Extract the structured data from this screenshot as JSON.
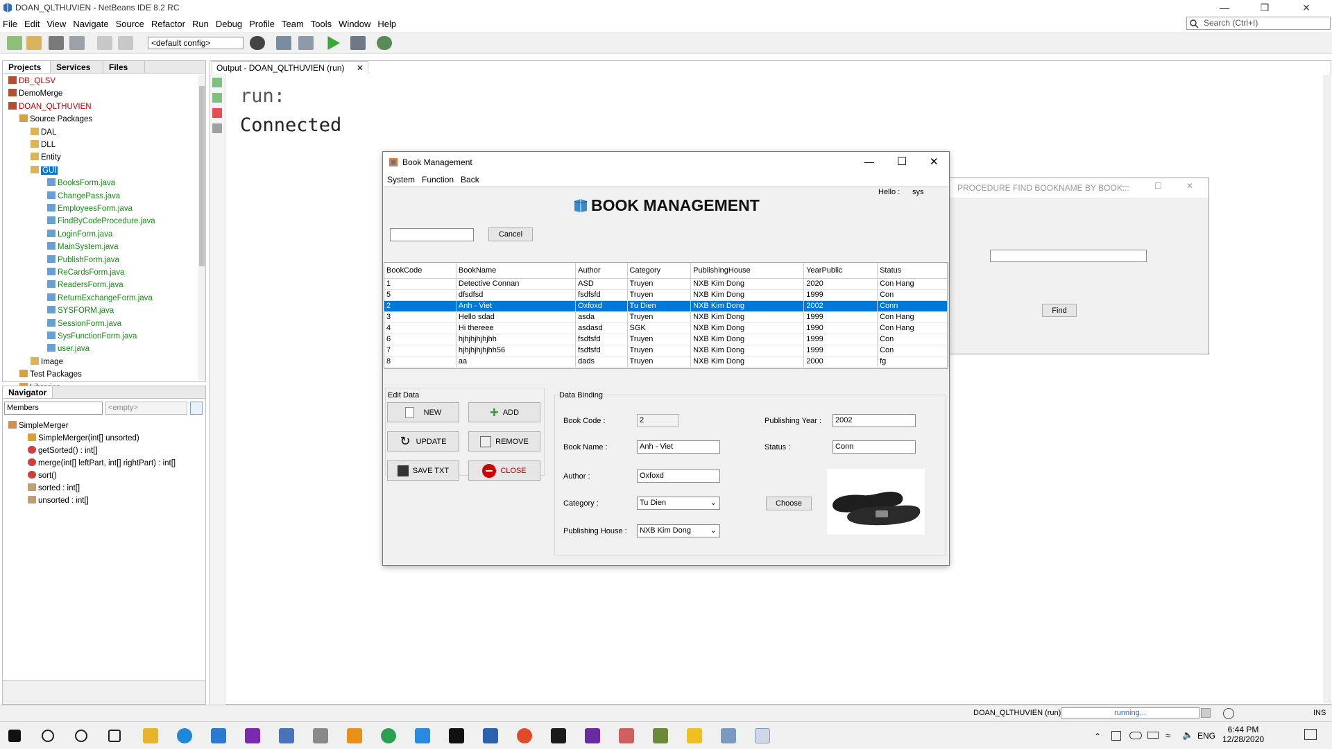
{
  "ide": {
    "title": "DOAN_QLTHUVIEN - NetBeans IDE 8.2 RC",
    "menu": [
      "File",
      "Edit",
      "View",
      "Navigate",
      "Source",
      "Refactor",
      "Run",
      "Debug",
      "Profile",
      "Team",
      "Tools",
      "Window",
      "Help"
    ],
    "search_placeholder": "Search (Ctrl+I)",
    "config": "<default config>"
  },
  "projects_panel": {
    "tabs": [
      "Projects",
      "Services",
      "Files"
    ],
    "tree": [
      {
        "label": "DB_QLSV",
        "color": "#c00000",
        "icon": "project-icon"
      },
      {
        "label": "DemoMerge",
        "color": "#000000",
        "icon": "project-icon"
      },
      {
        "label": "DOAN_QLTHUVIEN",
        "color": "#c00000",
        "icon": "project-icon"
      },
      {
        "label": "Source Packages",
        "color": "#000000",
        "icon": "folder-icon"
      },
      {
        "label": "DAL",
        "color": "#000000",
        "icon": "package-icon"
      },
      {
        "label": "DLL",
        "color": "#000000",
        "icon": "package-icon"
      },
      {
        "label": "Entity",
        "color": "#000000",
        "icon": "package-icon"
      },
      {
        "label": "GUI",
        "color": "#ffffff",
        "icon": "package-icon"
      },
      {
        "label": "BooksForm.java",
        "color": "#1a8a1a",
        "icon": "java-file-icon"
      },
      {
        "label": "ChangePass.java",
        "color": "#1a8a1a",
        "icon": "java-file-icon"
      },
      {
        "label": "EmployeesForm.java",
        "color": "#1a8a1a",
        "icon": "java-file-icon"
      },
      {
        "label": "FindByCodeProcedure.java",
        "color": "#1a8a1a",
        "icon": "java-file-icon"
      },
      {
        "label": "LoginForm.java",
        "color": "#1a8a1a",
        "icon": "java-file-icon"
      },
      {
        "label": "MainSystem.java",
        "color": "#1a8a1a",
        "icon": "java-file-icon"
      },
      {
        "label": "PublishForm.java",
        "color": "#1a8a1a",
        "icon": "java-file-icon"
      },
      {
        "label": "ReCardsForm.java",
        "color": "#1a8a1a",
        "icon": "java-file-icon"
      },
      {
        "label": "ReadersForm.java",
        "color": "#1a8a1a",
        "icon": "java-file-icon"
      },
      {
        "label": "ReturnExchangeForm.java",
        "color": "#1a8a1a",
        "icon": "java-file-icon"
      },
      {
        "label": "SYSFORM.java",
        "color": "#1a8a1a",
        "icon": "java-file-icon"
      },
      {
        "label": "SessionForm.java",
        "color": "#1a8a1a",
        "icon": "java-file-icon"
      },
      {
        "label": "SysFunctionForm.java",
        "color": "#1a8a1a",
        "icon": "java-file-icon"
      },
      {
        "label": "user.java",
        "color": "#1a8a1a",
        "icon": "java-file-icon"
      },
      {
        "label": "Image",
        "color": "#000000",
        "icon": "package-icon"
      },
      {
        "label": "Test Packages",
        "color": "#000000",
        "icon": "folder-icon"
      },
      {
        "label": "Libraries",
        "color": "#000000",
        "icon": "folder-icon"
      }
    ]
  },
  "navigator": {
    "title": "Navigator",
    "members_select": "Members",
    "filter_select": "<empty>",
    "items": [
      "SimpleMerger",
      "SimpleMerger(int[] unsorted)",
      "getSorted() : int[]",
      "merge(int[] leftPart, int[] rightPart) : int[]",
      "sort()",
      "sorted : int[]",
      "unsorted : int[]"
    ]
  },
  "output": {
    "tab_label": "Output - DOAN_QLTHUVIEN (run)",
    "lines": [
      "run:",
      "Connected"
    ]
  },
  "book_window": {
    "title": "Book Management",
    "menu": [
      "System",
      "Function",
      "Back"
    ],
    "hello_label": "Hello :",
    "hello_user": "sys",
    "heading": "BOOK MANAGEMENT",
    "search_value": "",
    "cancel_label": "Cancel",
    "columns": [
      "BookCode",
      "BookName",
      "Author",
      "Category",
      "PublishingHouse",
      "YearPublic",
      "Status"
    ],
    "rows": [
      [
        "1",
        "Detective Connan",
        "ASD",
        "Truyen",
        "NXB Kim Dong",
        "2020",
        "Con Hang"
      ],
      [
        "5",
        "dfsdfsd",
        "fsdfsfd",
        "Truyen",
        "NXB Kim Dong",
        "1999",
        "Con"
      ],
      [
        "2",
        "Anh - Viet",
        "Oxfoxd",
        "Tu Dien",
        "NXB Kim Dong",
        "2002",
        "Conn"
      ],
      [
        "3",
        "Hello sdad",
        "asda",
        "Truyen",
        "NXB Kim Dong",
        "1999",
        "Con Hang"
      ],
      [
        "4",
        "Hi thereee",
        "asdasd",
        "SGK",
        "NXB Kim Dong",
        "1990",
        "Con Hang"
      ],
      [
        "6",
        "hjhjhjhjhjhh",
        "fsdfsfd",
        "Truyen",
        "NXB Kim Dong",
        "1999",
        "Con"
      ],
      [
        "7",
        "hjhjhjhjhjhh56",
        "fsdfsfd",
        "Truyen",
        "NXB Kim Dong",
        "1999",
        "Con"
      ],
      [
        "8",
        "aa",
        "dads",
        "Truyen",
        "NXB Kim Dong",
        "2000",
        "fg"
      ]
    ],
    "selected_row": 2,
    "edit_data_label": "Edit Data",
    "buttons": {
      "new": "NEW",
      "add": "ADD",
      "update": "UPDATE",
      "remove": "REMOVE",
      "save_txt": "SAVE TXT",
      "close": "CLOSE"
    },
    "data_binding_label": "Data Binding",
    "form": {
      "book_code_label": "Book Code :",
      "book_code": "2",
      "book_name_label": "Book Name :",
      "book_name": "Anh - Viet",
      "author_label": "Author :",
      "author": "Oxfoxd",
      "category_label": "Category :",
      "category": "Tu Dien",
      "publishing_house_label": "Publishing House :",
      "publishing_house": "NXB Kim Dong",
      "publishing_year_label": "Publishing Year :",
      "publishing_year": "2002",
      "status_label": "Status :",
      "status": "Conn",
      "choose_label": "Choose"
    }
  },
  "procedure_window": {
    "title": "PROCEDURE FIND BOOKNAME BY BOOK...",
    "input_value": "",
    "find_label": "Find"
  },
  "status_bar": {
    "task": "DOAN_QLTHUVIEN (run)",
    "progress": "running...",
    "mode": "INS"
  },
  "taskbar": {
    "lang": "ENG",
    "time": "6:44 PM",
    "date": "12/28/2020"
  },
  "colors": {
    "selection": "#0078d7",
    "project_red": "#c00000",
    "file_green": "#1a8a1a"
  }
}
